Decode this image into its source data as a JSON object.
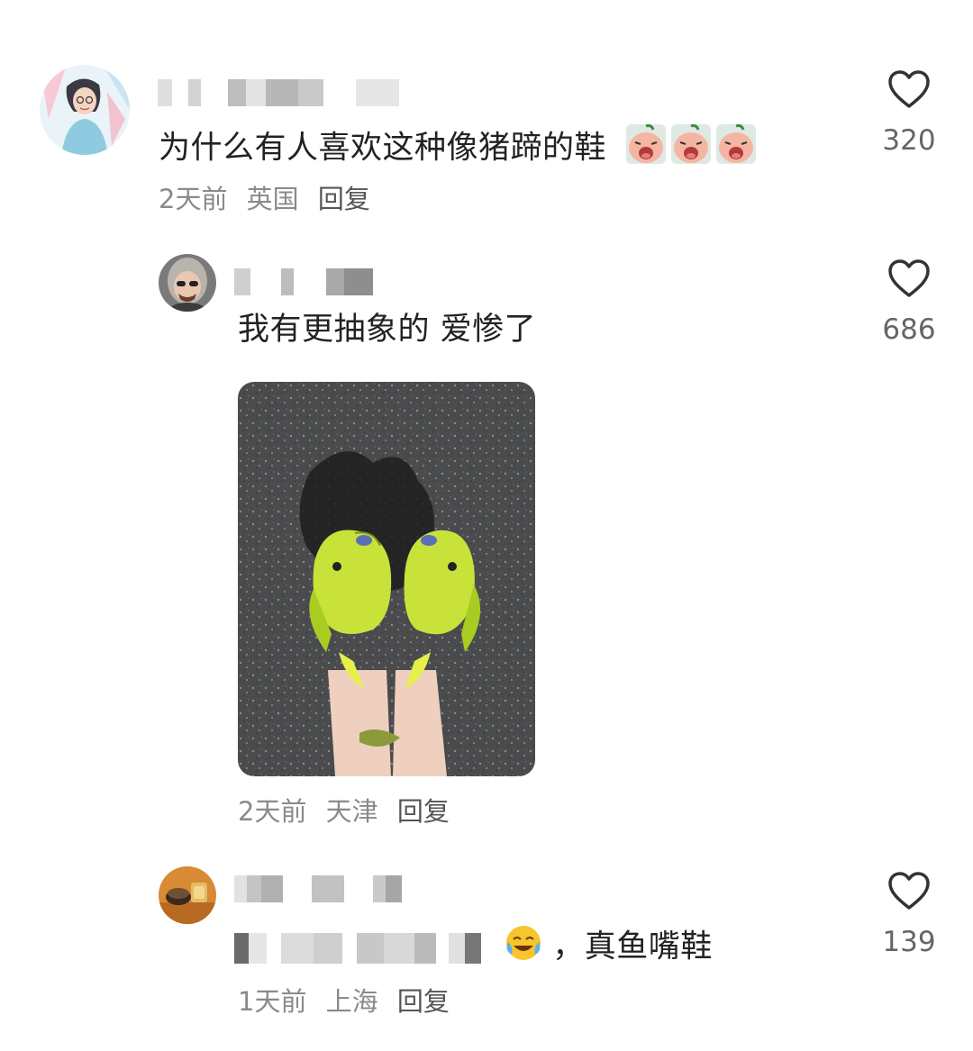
{
  "comments": [
    {
      "text": "为什么有人喜欢这种像猪蹄的鞋",
      "emoji": "crying-peach-emoji",
      "time": "2天前",
      "location": "英国",
      "reply_label": "回复",
      "likes": "320"
    },
    {
      "text": "我有更抽象的 爱惨了",
      "time": "2天前",
      "location": "天津",
      "reply_label": "回复",
      "likes": "686",
      "image": "fish-slippers-photo"
    },
    {
      "text_visible": "，真鱼嘴鞋",
      "emoji": "laughing-crying-emoji",
      "time": "1天前",
      "location": "上海",
      "reply_label": "回复",
      "likes": "139"
    }
  ],
  "icons": {
    "like": "heart-outline-icon"
  },
  "colors": {
    "meta_text": "#8a8a8a",
    "body_text": "#222222",
    "fish_green": "#c8e23a"
  }
}
